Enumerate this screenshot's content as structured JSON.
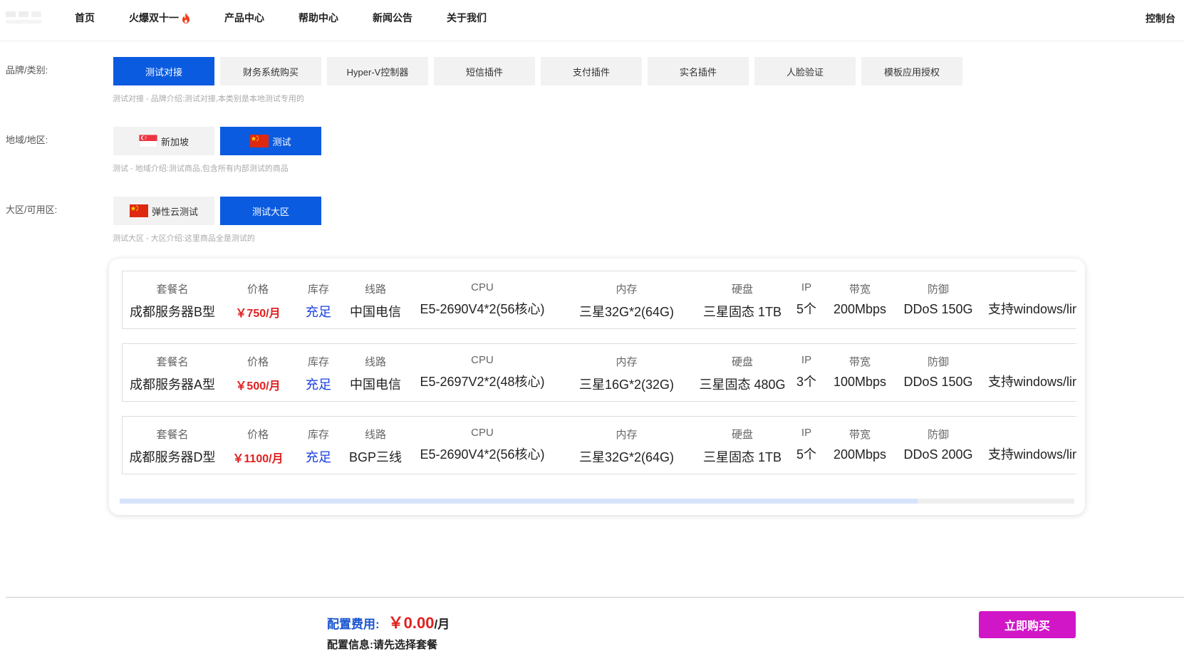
{
  "nav": {
    "items": [
      {
        "label": "首页"
      },
      {
        "label": "火爆双十一",
        "hot": true
      },
      {
        "label": "产品中心"
      },
      {
        "label": "帮助中心"
      },
      {
        "label": "新闻公告"
      },
      {
        "label": "关于我们"
      }
    ],
    "console": "控制台"
  },
  "brand": {
    "label": "品牌/类别:",
    "options": [
      "测试对接",
      "财务系统购买",
      "Hyper-V控制器",
      "短信插件",
      "支付插件",
      "实名插件",
      "人脸验证",
      "模板应用授权"
    ],
    "selected": "测试对接",
    "desc": "测试对接 - 品牌介绍:测试对接,本类别是本地测试专用的"
  },
  "region": {
    "label": "地域/地区:",
    "options": [
      {
        "label": "新加坡",
        "flag": "singapore-flag-icon"
      },
      {
        "label": "测试",
        "flag": "china-flag-icon"
      }
    ],
    "selected": "测试",
    "desc": "测试 - 地域介绍:测试商品,包含所有内部测试的商品"
  },
  "zone": {
    "label": "大区/可用区:",
    "options": [
      {
        "label": "弹性云测试",
        "flag": "china-flag-icon"
      },
      {
        "label": "测试大区"
      }
    ],
    "selected": "测试大区",
    "desc": "测试大区 - 大区介绍:这里商品全是测试的"
  },
  "plans": {
    "headers": [
      "套餐名",
      "价格",
      "库存",
      "线路",
      "CPU",
      "内存",
      "硬盘",
      "IP",
      "带宽",
      "防御"
    ],
    "rows": [
      {
        "name": "成都服务器B型",
        "price": "￥750/月",
        "stock": "充足",
        "line": "中国电信",
        "cpu": "E5-2690V4*2(56核心)",
        "ram": "三星32G*2(64G)",
        "disk": "三星固态 1TB",
        "ip": "5个",
        "bw": "200Mbps",
        "ddos": "DDoS 150G",
        "os": "支持windows/linux"
      },
      {
        "name": "成都服务器A型",
        "price": "￥500/月",
        "stock": "充足",
        "line": "中国电信",
        "cpu": "E5-2697V2*2(48核心)",
        "ram": "三星16G*2(32G)",
        "disk": "三星固态 480G",
        "ip": "3个",
        "bw": "100Mbps",
        "ddos": "DDoS 150G",
        "os": "支持windows/linux"
      },
      {
        "name": "成都服务器D型",
        "price": "￥1100/月",
        "stock": "充足",
        "line": "BGP三线",
        "cpu": "E5-2690V4*2(56核心)",
        "ram": "三星32G*2(64G)",
        "disk": "三星固态 1TB",
        "ip": "5个",
        "bw": "200Mbps",
        "ddos": "DDoS 200G",
        "os": "支持windows/linux"
      }
    ]
  },
  "summary": {
    "cost_label": "配置费用:",
    "cost_value": "￥0.00",
    "cost_unit": "/月",
    "config_label": "配置信息:",
    "config_value": "请先选择套餐",
    "buy_label": "立即购买"
  },
  "colors": {
    "accent": "#0a5be0",
    "price": "#e02020",
    "buy": "#d016c6"
  }
}
